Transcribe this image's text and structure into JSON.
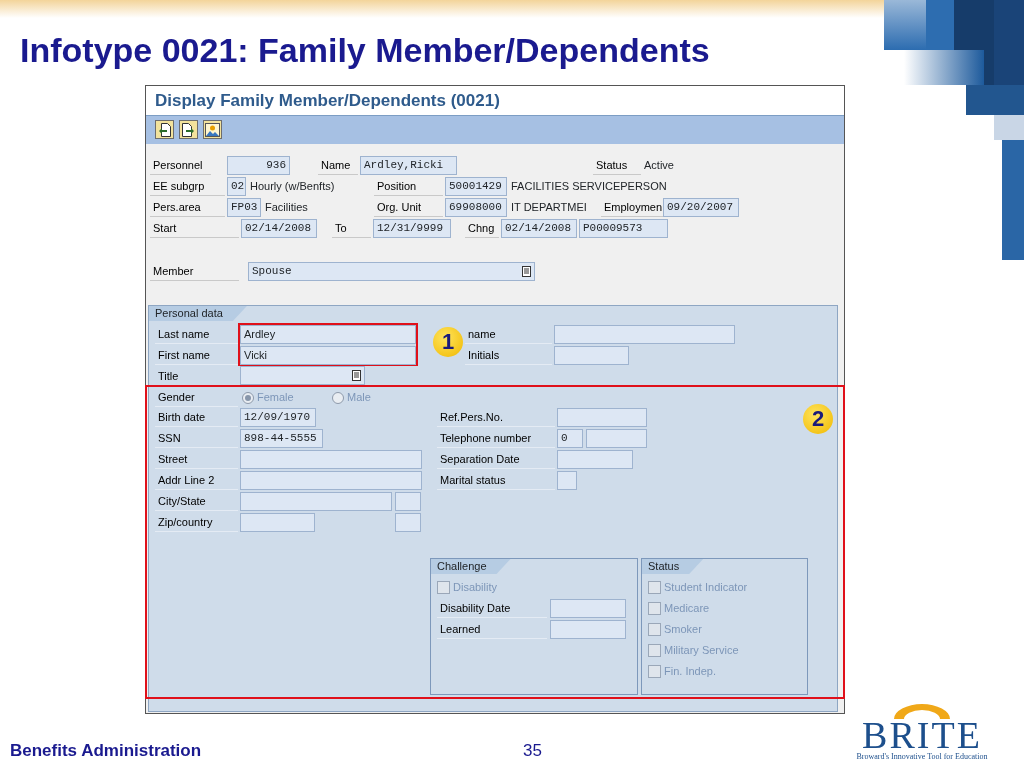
{
  "slide": {
    "title": "Infotype 0021: Family Member/Dependents",
    "footer": "Benefits Administration",
    "page_number": "35",
    "logo": {
      "name": "BRITE",
      "tagline": "Broward's Innovative Tool for Education"
    }
  },
  "window": {
    "title": "Display Family Member/Dependents (0021)"
  },
  "toolbar": [
    {
      "kind": "previous"
    },
    {
      "kind": "next"
    },
    {
      "kind": "image"
    }
  ],
  "header_rows": [
    [
      {
        "kind": "label",
        "text": "Personnel"
      },
      {
        "kind": "field",
        "value": "936"
      },
      {
        "kind": "label",
        "text": "Name"
      },
      {
        "kind": "field",
        "value": "Ardley,Ricki"
      },
      {
        "kind": "label",
        "text": "Status"
      },
      {
        "kind": "text",
        "text": "Active"
      }
    ],
    [
      {
        "kind": "label",
        "text": "EE subgrp"
      },
      {
        "kind": "field",
        "value": "02"
      },
      {
        "kind": "text",
        "text": "Hourly  (w/Benfts)"
      },
      {
        "kind": "label",
        "text": "Position"
      },
      {
        "kind": "field",
        "value": "50001429"
      },
      {
        "kind": "text",
        "text": "FACILITIES SERVICEPERSON"
      }
    ],
    [
      {
        "kind": "label",
        "text": "Pers.area"
      },
      {
        "kind": "field",
        "value": "FP03"
      },
      {
        "kind": "text",
        "text": "Facilities"
      },
      {
        "kind": "label",
        "text": "Org. Unit"
      },
      {
        "kind": "field",
        "value": "69908000"
      },
      {
        "kind": "text",
        "text": "IT DEPARTMEI"
      },
      {
        "kind": "label",
        "text": "Employmen"
      },
      {
        "kind": "field",
        "value": "09/20/2007"
      }
    ],
    [
      {
        "kind": "label",
        "text": "Start"
      },
      {
        "kind": "field",
        "value": "02/14/2008"
      },
      {
        "kind": "label",
        "text": "To"
      },
      {
        "kind": "field",
        "value": "12/31/9999"
      },
      {
        "kind": "label",
        "text": "Chng"
      },
      {
        "kind": "field",
        "value": "02/14/2008"
      },
      {
        "kind": "field",
        "value": "P00009573"
      }
    ]
  ],
  "member": {
    "label": "Member",
    "value": "Spouse"
  },
  "personal_data": {
    "title": "Personal data",
    "top_left": [
      {
        "label": "Last name",
        "value": "Ardley"
      },
      {
        "label": "First name",
        "value": "Vicki"
      },
      {
        "label": "Title"
      }
    ],
    "top_right": [
      {
        "label": "name"
      },
      {
        "label": "Initials"
      }
    ],
    "gender": {
      "label": "Gender",
      "options": [
        {
          "label": "Female",
          "selected": true,
          "disabled": true
        },
        {
          "label": "Male",
          "selected": false,
          "disabled": true
        }
      ]
    },
    "lower_left": [
      {
        "label": "Birth date",
        "values": [
          "12/09/1970"
        ]
      },
      {
        "label": "SSN",
        "values": [
          "898-44-5555"
        ]
      },
      {
        "label": "Street"
      },
      {
        "label": "Addr Line 2"
      },
      {
        "label": "City/State"
      },
      {
        "label": "Zip/country"
      }
    ],
    "lower_right": [
      {
        "label": "Ref.Pers.No."
      },
      {
        "label": "Telephone number",
        "values": [
          "0"
        ]
      },
      {
        "label": "Separation Date"
      },
      {
        "label": "Marital status"
      }
    ],
    "challenge": {
      "title": "Challenge",
      "checkboxes": [
        {
          "label": "Disability",
          "checked": false,
          "disabled": true
        }
      ],
      "fields": [
        {
          "label": "Disability Date"
        },
        {
          "label": "Learned"
        }
      ]
    },
    "status": {
      "title": "Status",
      "checkboxes": [
        {
          "label": "Student Indicator",
          "checked": false,
          "disabled": true
        },
        {
          "label": "Medicare",
          "checked": false,
          "disabled": true
        },
        {
          "label": "Smoker",
          "checked": false,
          "disabled": true
        },
        {
          "label": "Military Service",
          "checked": false,
          "disabled": true
        },
        {
          "label": "Fin. Indep.",
          "checked": false,
          "disabled": true
        }
      ]
    }
  },
  "callouts": [
    {
      "label": "1"
    },
    {
      "label": "2"
    }
  ]
}
